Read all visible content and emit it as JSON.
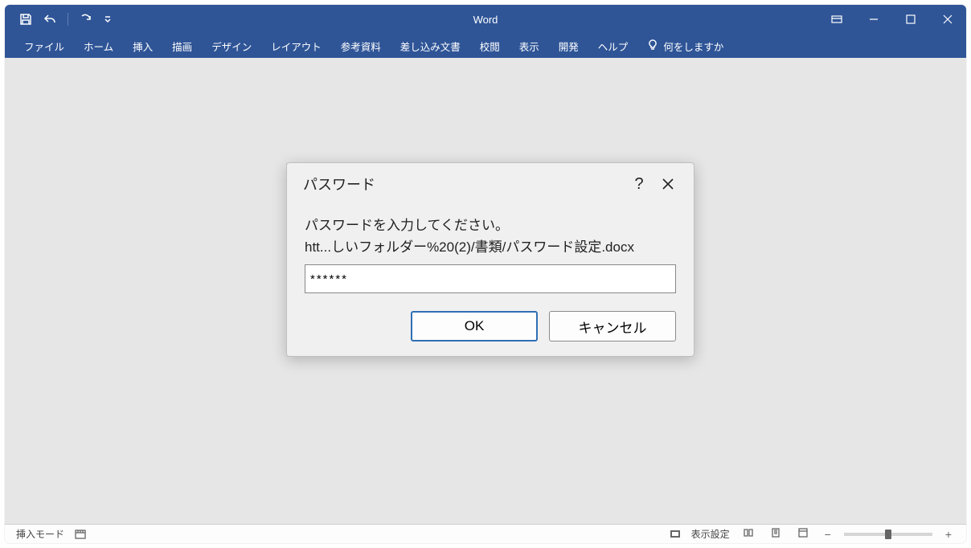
{
  "app": {
    "title": "Word"
  },
  "ribbon": {
    "tabs": [
      "ファイル",
      "ホーム",
      "挿入",
      "描画",
      "デザイン",
      "レイアウト",
      "参考資料",
      "差し込み文書",
      "校閲",
      "表示",
      "開発",
      "ヘルプ"
    ],
    "tellme_placeholder": "何をしますか"
  },
  "dialog": {
    "title": "パスワード",
    "prompt": "パスワードを入力してください。",
    "filepath": "htt...しいフォルダー%20(2)/書類/パスワード設定.docx",
    "password_value": "******",
    "ok_label": "OK",
    "cancel_label": "キャンセル"
  },
  "statusbar": {
    "mode": "挿入モード",
    "display_settings": "表示設定"
  }
}
